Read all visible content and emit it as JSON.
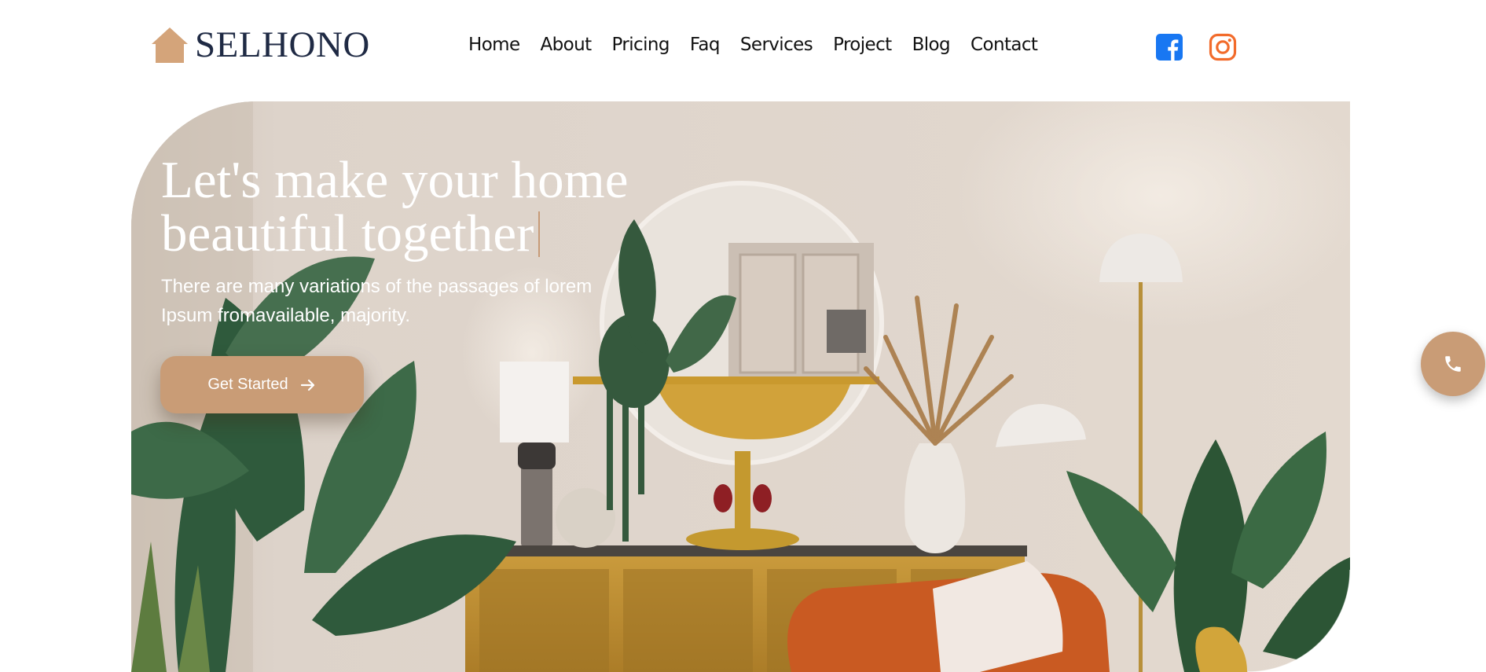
{
  "brand": {
    "name": "SELHONO",
    "logo_icon": "house-icon",
    "logo_color": "#d4a47a",
    "text_color": "#1f2a44"
  },
  "nav": {
    "items": [
      {
        "label": "Home"
      },
      {
        "label": "About"
      },
      {
        "label": "Pricing"
      },
      {
        "label": "Faq"
      },
      {
        "label": "Services"
      },
      {
        "label": "Project"
      },
      {
        "label": "Blog"
      },
      {
        "label": "Contact"
      }
    ]
  },
  "social": {
    "facebook_icon": "facebook-icon",
    "facebook_color": "#1877f2",
    "instagram_icon": "instagram-icon",
    "instagram_color": "#f26b2b"
  },
  "hero": {
    "title": "Let's make your home beautiful together",
    "subtitle": "There are many variations of the passages of lorem Ipsum fromavailable, majority.",
    "cta_label": "Get Started",
    "cta_icon": "arrow-right-icon",
    "accent_color": "#c99c76",
    "image": "living-room-interior-photo"
  },
  "floating_action": {
    "icon": "phone-icon",
    "color": "#c99c76"
  }
}
